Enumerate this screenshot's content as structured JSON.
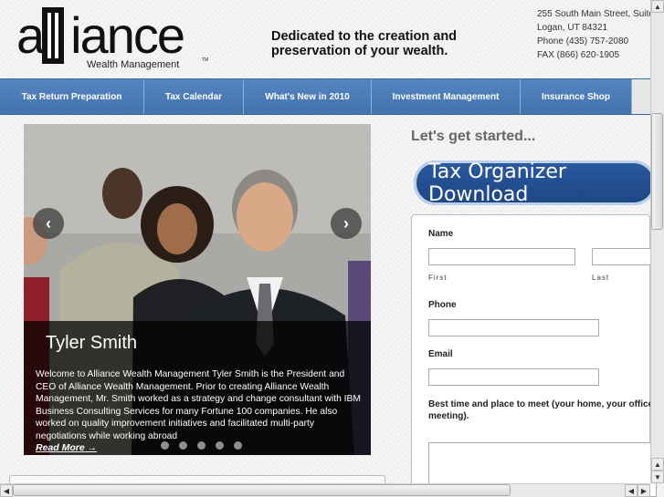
{
  "header": {
    "logo_text": "alliance",
    "logo_sub": "Wealth Management",
    "logo_tm": "TM",
    "tagline": "Dedicated to the creation and preservation of your wealth.",
    "address": [
      "255 South Main Street, Suite",
      "Logan, UT 84321",
      "Phone (435) 757-2080",
      "FAX (866) 620-1905"
    ]
  },
  "nav": [
    {
      "label": "Tax Return Preparation"
    },
    {
      "label": "Tax Calendar"
    },
    {
      "label": "What's New in 2010"
    },
    {
      "label": "Investment Management"
    },
    {
      "label": "Insurance Shop"
    },
    {
      "label": ""
    }
  ],
  "slider": {
    "title": "Tyler Smith",
    "text": "Welcome to Alliance Wealth Management Tyler Smith is the President and CEO of Alliance Wealth Management. Prior to creating Alliance Wealth Management, Mr. Smith worked as a strategy and change consultant with IBM Business Consulting Services for many Fortune 100 companies. He also worked on quality improvement initiatives and facilitated multi-party negotiations while working abroad",
    "read_more": "Read More →",
    "prev": "‹",
    "next": "›"
  },
  "form": {
    "heading": "Let's get started...",
    "download_label": "Tax Organizer Download",
    "name_label": "Name",
    "first_label": "First",
    "last_label": "Last",
    "phone_label": "Phone",
    "email_label": "Email",
    "meet_label": "Best time and place to meet (your home, your office, meeting)."
  },
  "scrollbar": {
    "up": "▲",
    "down": "▼",
    "left": "◀",
    "right": "▶"
  }
}
